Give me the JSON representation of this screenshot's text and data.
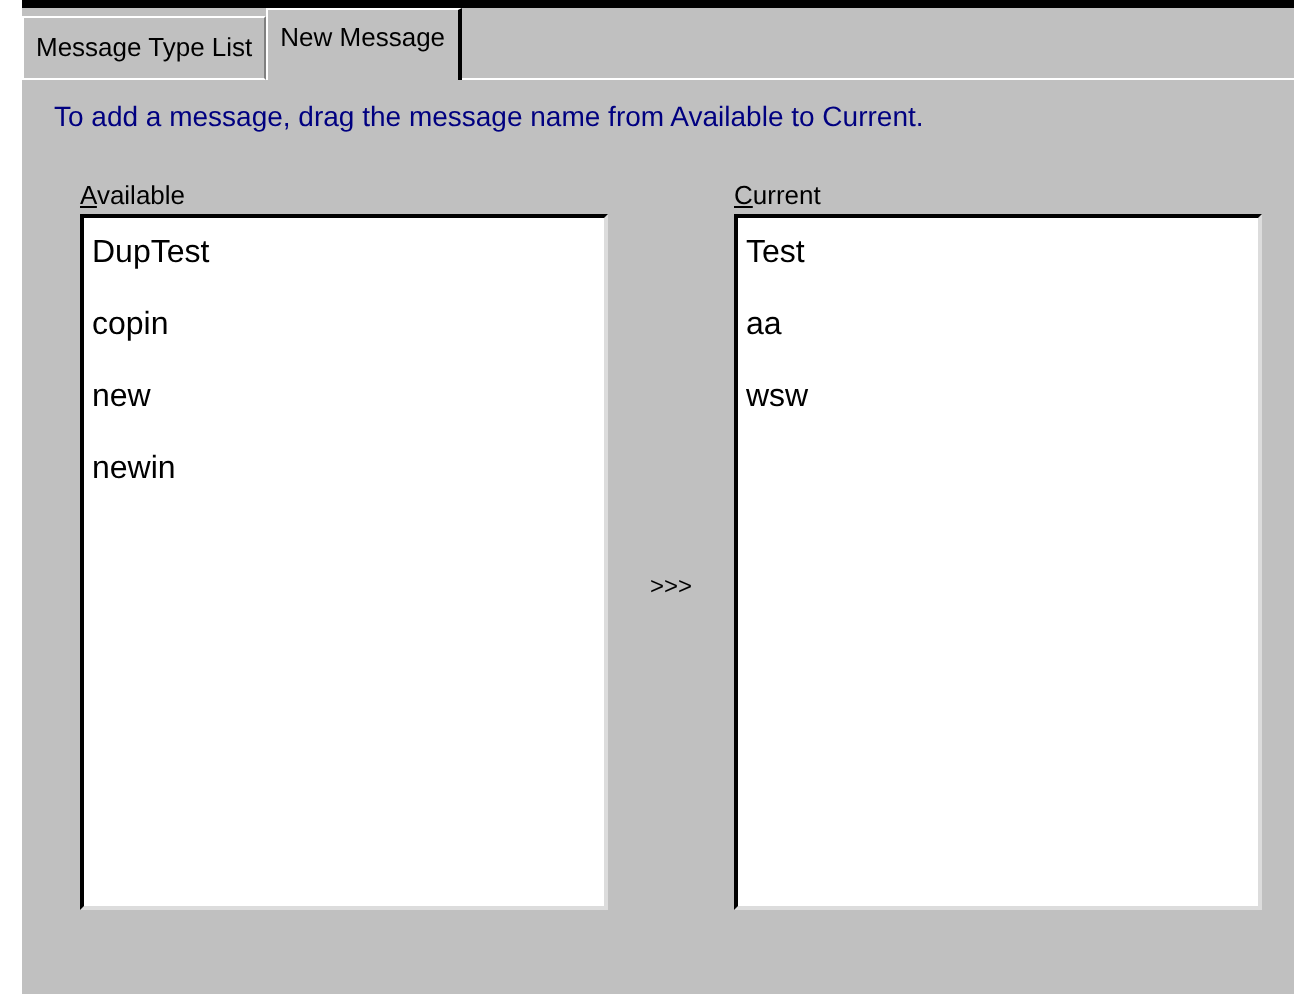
{
  "tabs": [
    {
      "label": "Message Type List",
      "selected": false
    },
    {
      "label": "New Message",
      "selected": true
    }
  ],
  "instruction": "To add a message, drag the message name from Available to Current.",
  "available": {
    "label": "Available",
    "items": [
      "DupTest",
      "copin",
      "new",
      "newin"
    ]
  },
  "move_button": ">>>",
  "current": {
    "label": "Current",
    "items": [
      "Test",
      "aa",
      "wsw"
    ]
  }
}
